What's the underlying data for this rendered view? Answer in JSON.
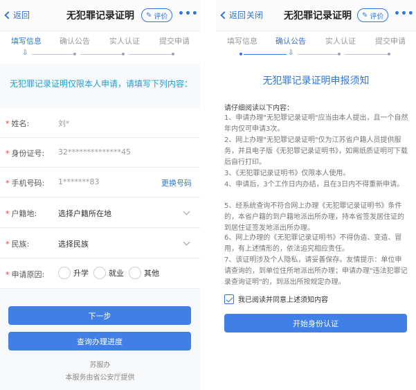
{
  "left": {
    "nav": {
      "back": "返回",
      "title": "无犯罪记录证明",
      "rate": "评价",
      "more": "•••"
    },
    "steps": [
      "填写信息",
      "确认公告",
      "实人认证",
      "提交申请"
    ],
    "notice": "无犯罪记录证明仅限本人申请，请填写下列内容：",
    "form": {
      "name_label": "姓名:",
      "name_value": "刘*",
      "id_label": "身份证号:",
      "id_value": "32**************45",
      "phone_label": "手机号码:",
      "phone_value": "1*******83",
      "change_phone": "更换号码",
      "origin_label": "户籍地:",
      "origin_placeholder": "选择户籍所在地",
      "ethnic_label": "民族:",
      "ethnic_placeholder": "选择民族",
      "reason_label": "申请原因:",
      "reasons": [
        "升学",
        "就业",
        "其他"
      ]
    },
    "next": "下一步",
    "progress": "查询办理进度",
    "footer_app": "苏服办",
    "footer_provider": "本服务由省公安厅提供"
  },
  "right": {
    "nav": {
      "back": "返回",
      "close": "关闭",
      "title": "无犯罪记录证明",
      "rate": "评价",
      "more": "•••"
    },
    "steps": [
      "填写信息",
      "确认公告",
      "实人认证",
      "提交申请"
    ],
    "title": "无犯罪记录证明申报须知",
    "instr": "请仔细阅读以下内容：",
    "rules": [
      "1、申请办理\"无犯罪记录证明\"应当由本人提出，且一个自然年内仅可申请3次。",
      "2、网上办理\"无犯罪记录证明\"仅为江苏省户籍人员提供服务，并且电子版《无犯罪记录证明书》，如需纸质证明可下载后自行打印。",
      "3、《无犯罪记录证明书》仅限本人使用。",
      "4、申请后，3个工作日内办结，且在3日内不得重新申请。",
      "5、经系统查询不符合网上办理《无犯罪记录证明书》条件的，本省户籍的到户籍地派出所办理，持本省签发居住证的到居住证签发地派出所办理。",
      "6、网上办理的《无犯罪记录证明书》不得伪造、变造、冒用，有上述情形的，依法追究相应责任。",
      "7、该证明涉及个人隐私，请妥善保存。友情提示：单位申请查询的，到单位住所地派出所办理；申请办理\"违法犯罪记录查询证明\"的，到派出所按规定办理。"
    ],
    "agree": "我已阅读并同意上述须知内容",
    "start": "开始身份认证"
  },
  "colors": {
    "accent": "#2f76d8",
    "notice": "#1a9fd6",
    "button": "#3f7fe6",
    "required": "#e83b3b"
  }
}
